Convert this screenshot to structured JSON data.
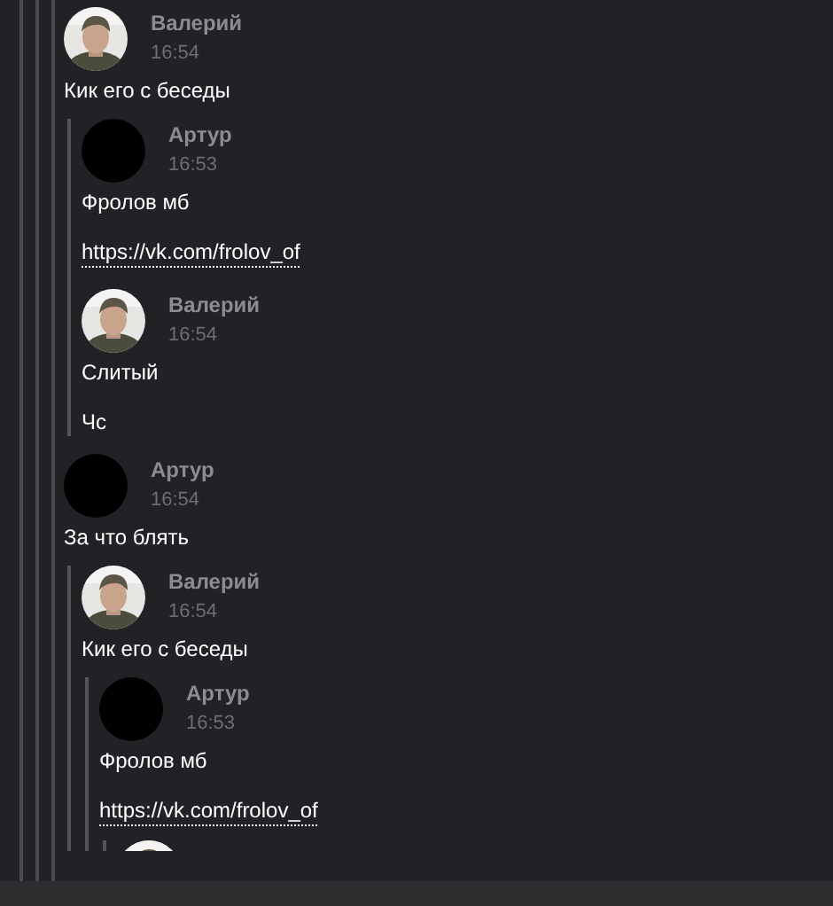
{
  "messages": [
    {
      "author": "Валерий",
      "time": "16:54",
      "avatar": {
        "kind": "picture"
      },
      "texts": [
        {
          "kind": "text",
          "text": "Кик его с беседы"
        }
      ],
      "forwarded": [
        {
          "author": "Артур",
          "time": "16:53",
          "avatar": {
            "kind": "blank"
          },
          "texts": [
            {
              "kind": "text",
              "text": "Фролов мб"
            },
            {
              "kind": "link",
              "text": "https://vk.com/frolov_of"
            }
          ]
        },
        {
          "author": "Валерий",
          "time": "16:54",
          "avatar": {
            "kind": "picture"
          },
          "texts": [
            {
              "kind": "text",
              "text": "Слитый"
            },
            {
              "kind": "text",
              "text": "Чс"
            }
          ]
        }
      ]
    },
    {
      "author": "Артур",
      "time": "16:54",
      "avatar": {
        "kind": "blank"
      },
      "texts": [
        {
          "kind": "text",
          "text": "За что блять"
        }
      ],
      "forwarded": [
        {
          "author": "Валерий",
          "time": "16:54",
          "avatar": {
            "kind": "picture"
          },
          "texts": [
            {
              "kind": "text",
              "text": "Кик его с беседы"
            }
          ],
          "forwarded": [
            {
              "author": "Артур",
              "time": "16:53",
              "avatar": {
                "kind": "blank"
              },
              "texts": [
                {
                  "kind": "text",
                  "text": "Фролов мб"
                },
                {
                  "kind": "link",
                  "text": "https://vk.com/frolov_of"
                }
              ],
              "forwarded": [
                {
                  "avatar": {
                    "kind": "picture"
                  }
                }
              ]
            }
          ]
        }
      ]
    }
  ]
}
